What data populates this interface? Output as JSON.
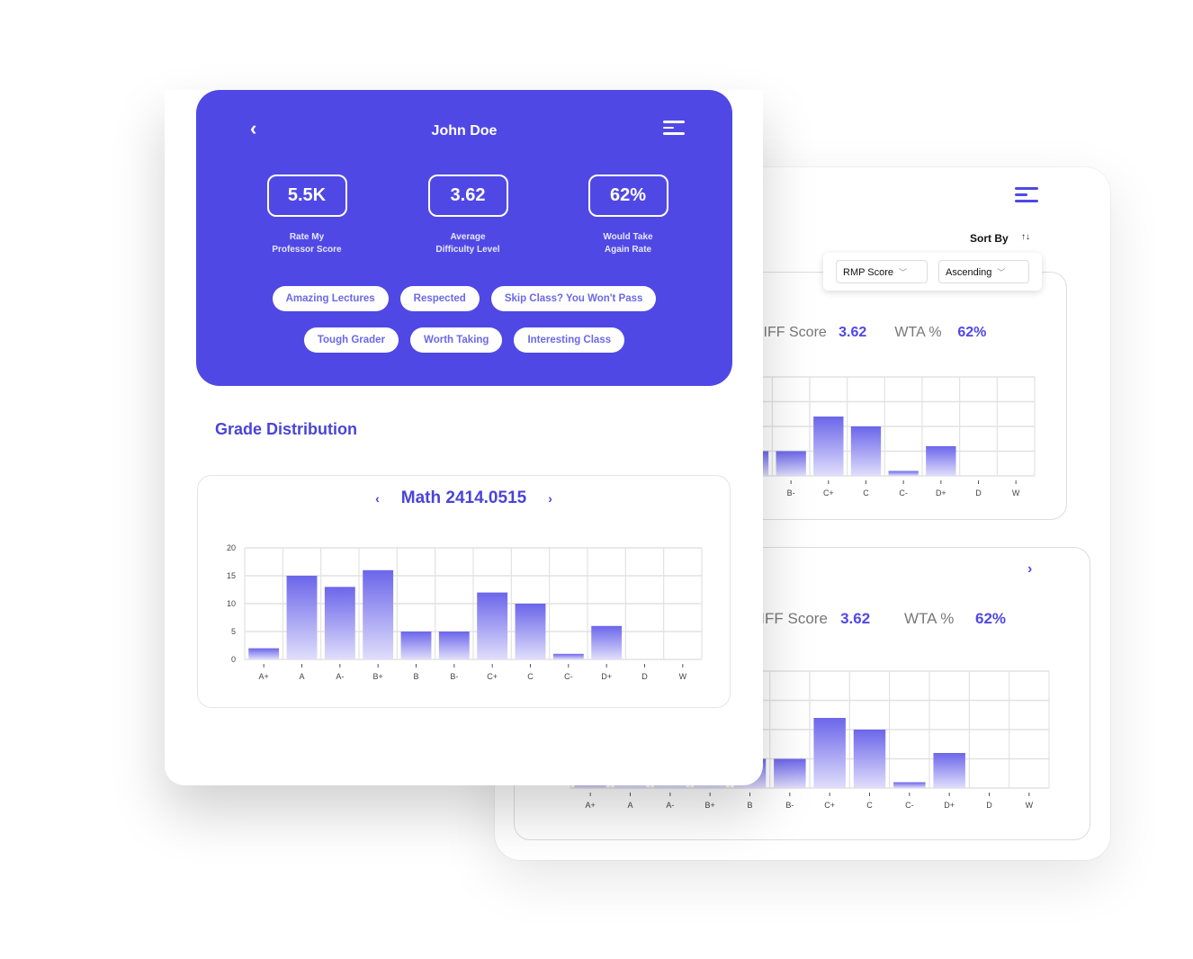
{
  "profile": {
    "name": "John Doe",
    "back_icon": "chevron-left-icon",
    "menu_icon": "menu-icon",
    "stats": [
      {
        "value": "5.5K",
        "label": "Rate My\nProfessor Score"
      },
      {
        "value": "3.62",
        "label": "Average\nDifficulty Level"
      },
      {
        "value": "62%",
        "label": "Would Take\nAgain Rate"
      }
    ],
    "tags_row1": [
      "Amazing Lectures",
      "Respected",
      "Skip Class? You Won't Pass"
    ],
    "tags_row2": [
      "Tough Grader",
      "Worth Taking",
      "Interesting Class"
    ]
  },
  "grade_distribution": {
    "title": "Grade Distribution",
    "course": "Math 2414.0515",
    "prev_icon": "chevron-left-icon",
    "next_icon": "chevron-right-icon"
  },
  "sort": {
    "label": "Sort By",
    "icon": "sort-arrows-icon",
    "field": "RMP Score",
    "order": "Ascending"
  },
  "list_cards": [
    {
      "diff_label": "DIFF Score",
      "diff_value": "3.62",
      "wta_label": "WTA %",
      "wta_value": "62%"
    },
    {
      "diff_label": "DIFF Score",
      "diff_value": "3.62",
      "wta_label": "WTA %",
      "wta_value": "62%"
    }
  ],
  "colors": {
    "primary": "#5048e5",
    "bar_top": "#6b66ea",
    "bar_bottom": "#e0defb"
  },
  "chart_data": {
    "type": "bar",
    "title": "Grade Distribution",
    "categories": [
      "A+",
      "A",
      "A-",
      "B+",
      "B",
      "B-",
      "C+",
      "C",
      "C-",
      "D+",
      "D",
      "W"
    ],
    "values": [
      2,
      15,
      13,
      16,
      5,
      5,
      12,
      10,
      1,
      6,
      0,
      0
    ],
    "yticks": [
      0,
      5,
      10,
      15,
      20
    ],
    "ylim": [
      0,
      20
    ],
    "xlabel": "",
    "ylabel": "",
    "grid": true
  }
}
